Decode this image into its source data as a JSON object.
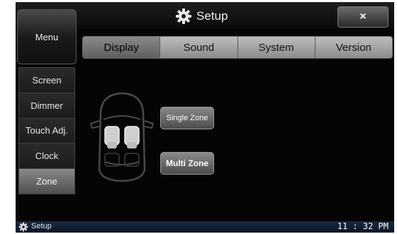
{
  "title_bar": {
    "title": "Setup",
    "title_icon": "gear-icon",
    "close_label": "×"
  },
  "menu_button": {
    "label": "Menu"
  },
  "tabs": [
    {
      "label": "Display",
      "active": true
    },
    {
      "label": "Sound",
      "active": false
    },
    {
      "label": "System",
      "active": false
    },
    {
      "label": "Version",
      "active": false
    }
  ],
  "sidebar": {
    "items": [
      {
        "label": "Screen",
        "active": false
      },
      {
        "label": "Dimmer",
        "active": false
      },
      {
        "label": "Touch Adj.",
        "active": false
      },
      {
        "label": "Clock",
        "active": false
      },
      {
        "label": "Zone",
        "active": true
      }
    ]
  },
  "zone": {
    "illustration": "car-top-view-icon",
    "single_label": "Single Zone",
    "multi_label": "Multi Zone"
  },
  "status_bar": {
    "app_label": "Setup",
    "app_icon": "gear-icon",
    "time": "11 : 32 PM"
  },
  "colors": {
    "screen_bg": "#050505",
    "tab_bg": "#a5a5a5",
    "status_bar_bg": "#0f1d31"
  }
}
